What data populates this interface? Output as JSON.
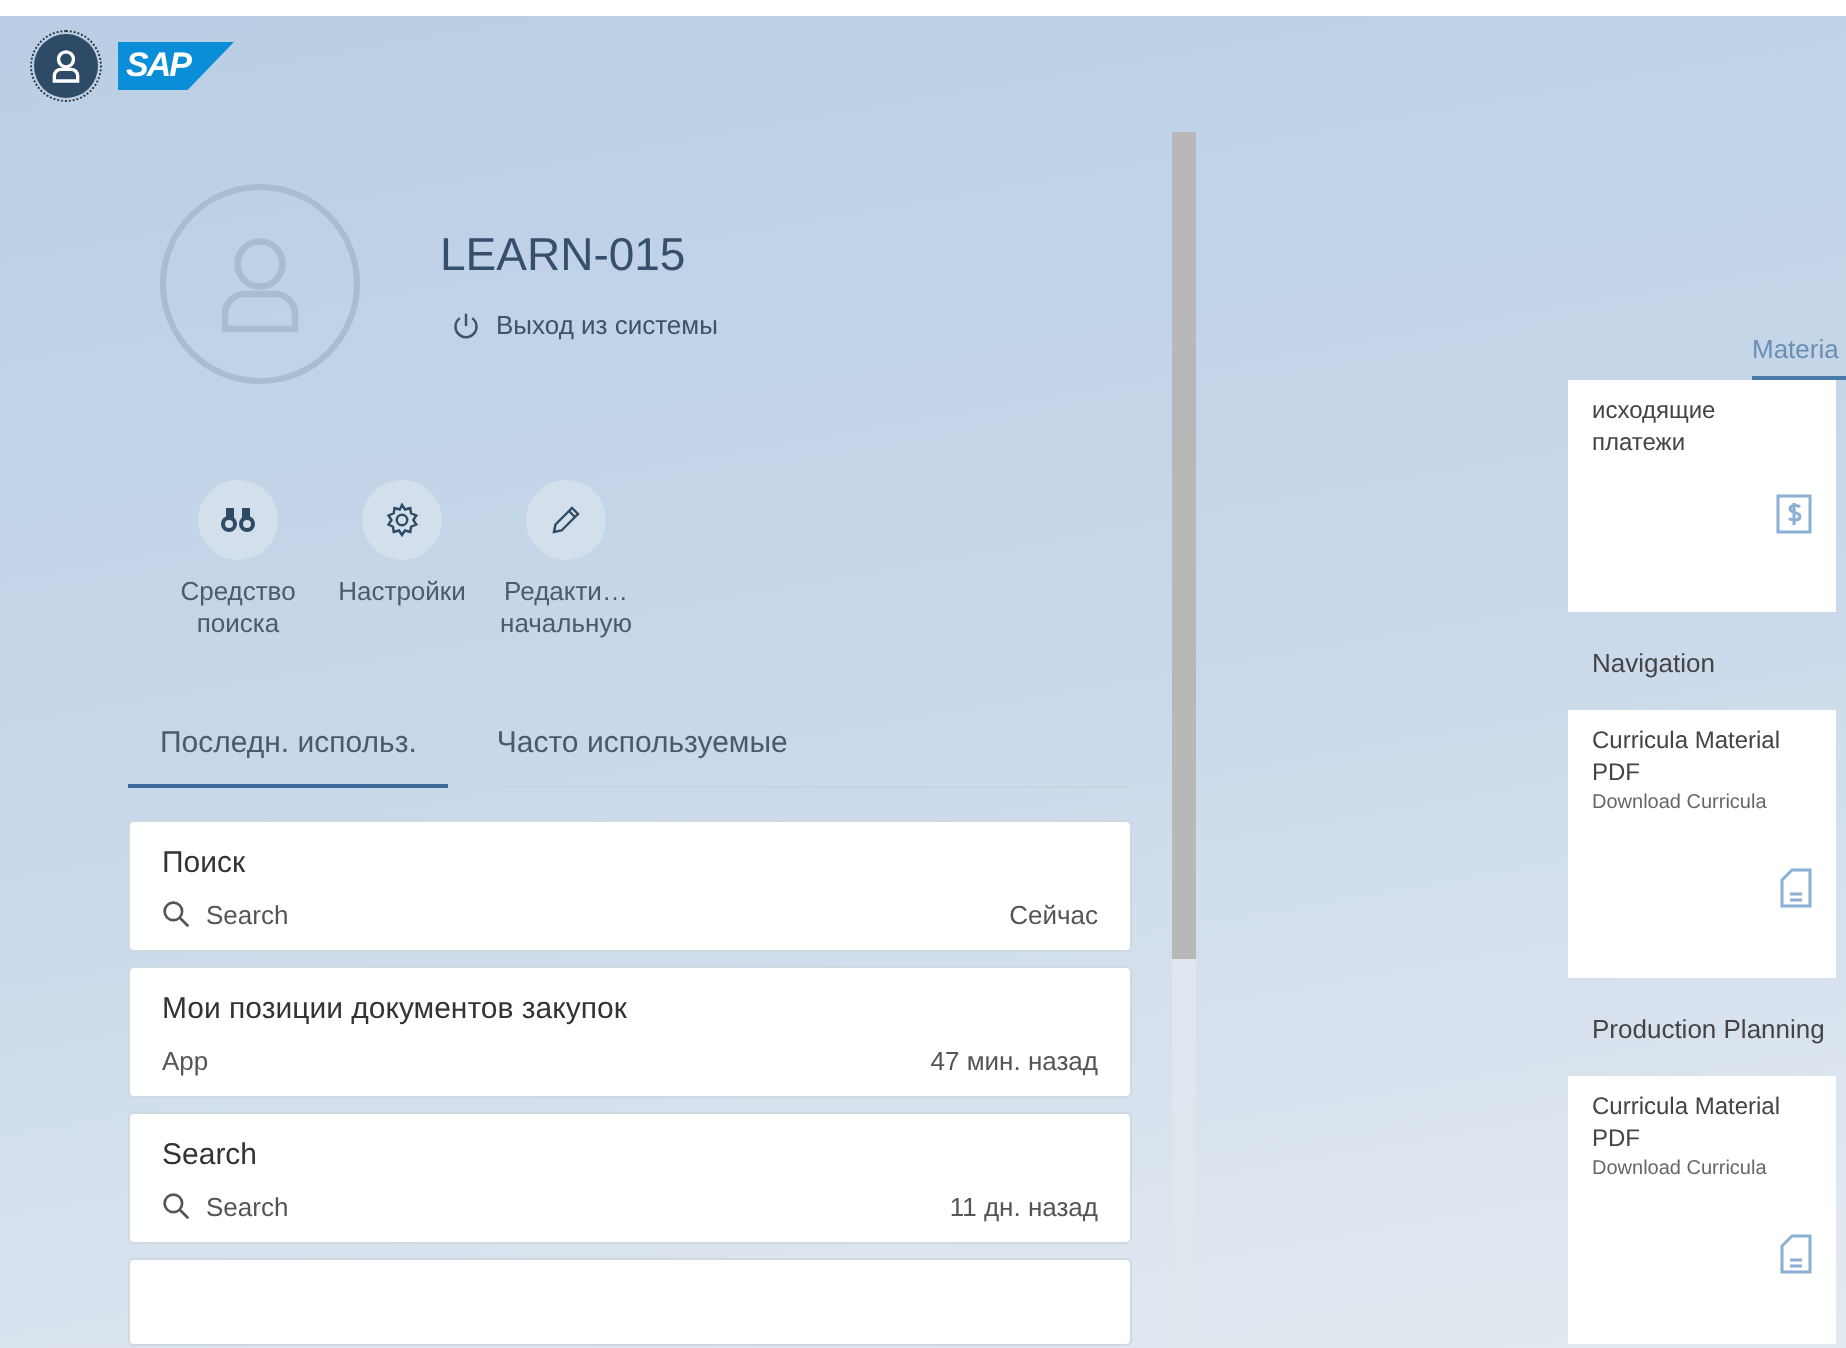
{
  "header": {
    "logo": "SAP"
  },
  "user": {
    "name": "LEARN-015",
    "logout": "Выход из системы"
  },
  "actions": [
    {
      "kind": "search",
      "label": "Средство поиска"
    },
    {
      "kind": "settings",
      "label": "Настройки"
    },
    {
      "kind": "edit",
      "label": "Редакти… начальную"
    }
  ],
  "tabs": [
    {
      "label": "Последн. использ.",
      "selected": true
    },
    {
      "label": "Часто используемые",
      "selected": false
    }
  ],
  "recent": [
    {
      "title": "Поиск",
      "kind": "search",
      "type": "Search",
      "time": "Сейчас"
    },
    {
      "title": "Мои позиции документов закупок",
      "kind": "app",
      "type": "App",
      "time": "47 мин. назад"
    },
    {
      "title": "Search",
      "kind": "search",
      "type": "Search",
      "time": "11 дн. назад"
    }
  ],
  "right": {
    "tab": {
      "label": "Materia",
      "selected": true
    },
    "top_tile": {
      "title": "исходящие платежи",
      "kind": "dollar"
    },
    "groups": [
      {
        "title": "Navigation",
        "tiles": [
          {
            "title": "Curricula Material PDF",
            "subtitle": "Download Curricula",
            "kind": "document"
          }
        ]
      },
      {
        "title": "Production Planning",
        "tiles": [
          {
            "title": "Curricula Material PDF",
            "subtitle": "Download Curricula",
            "kind": "document"
          }
        ]
      }
    ]
  }
}
